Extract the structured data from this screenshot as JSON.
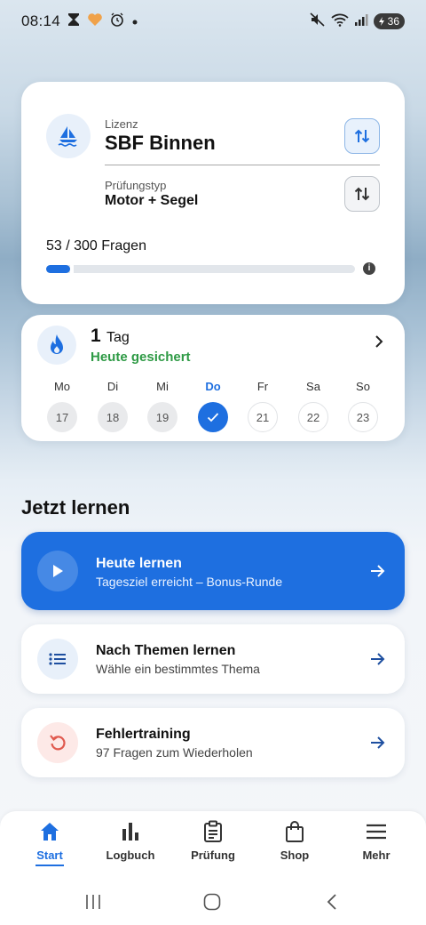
{
  "status_bar": {
    "time": "08:14",
    "battery": "36",
    "icons": [
      "hourglass-icon",
      "heart-icon",
      "alarm-icon",
      "dot-icon",
      "mute-icon",
      "wifi-icon",
      "signal-icon",
      "battery-icon"
    ]
  },
  "license": {
    "label": "Lizenz",
    "value": "SBF Binnen",
    "exam_label": "Prüfungstyp",
    "exam_value": "Motor + Segel",
    "progress_text": "53 / 300 Fragen",
    "progress_fraction": 0.1767
  },
  "streak": {
    "days": "1",
    "unit": "Tag",
    "status": "Heute gesichert",
    "status_color": "#2e9a45",
    "week": [
      {
        "label": "Mo",
        "date": "17",
        "state": "past"
      },
      {
        "label": "Di",
        "date": "18",
        "state": "past"
      },
      {
        "label": "Mi",
        "date": "19",
        "state": "past"
      },
      {
        "label": "Do",
        "date": "",
        "state": "done"
      },
      {
        "label": "Fr",
        "date": "21",
        "state": "future"
      },
      {
        "label": "Sa",
        "date": "22",
        "state": "future"
      },
      {
        "label": "So",
        "date": "23",
        "state": "future"
      }
    ]
  },
  "section_title": "Jetzt lernen",
  "actions": {
    "today": {
      "title": "Heute lernen",
      "subtitle": "Tagesziel erreicht – Bonus-Runde"
    },
    "themes": {
      "title": "Nach Themen lernen",
      "subtitle": "Wähle ein bestimmtes Thema"
    },
    "errors": {
      "title": "Fehlertraining",
      "subtitle": "97 Fragen zum Wiederholen"
    }
  },
  "nav": {
    "items": [
      {
        "label": "Start",
        "icon": "home-icon",
        "active": true
      },
      {
        "label": "Logbuch",
        "icon": "bar-chart-icon",
        "active": false
      },
      {
        "label": "Prüfung",
        "icon": "clipboard-icon",
        "active": false
      },
      {
        "label": "Shop",
        "icon": "shopping-bag-icon",
        "active": false
      },
      {
        "label": "Mehr",
        "icon": "menu-icon",
        "active": false
      }
    ]
  },
  "colors": {
    "accent": "#1e6fe0",
    "success": "#2e9a45",
    "error_icon": "#e05a4f"
  }
}
